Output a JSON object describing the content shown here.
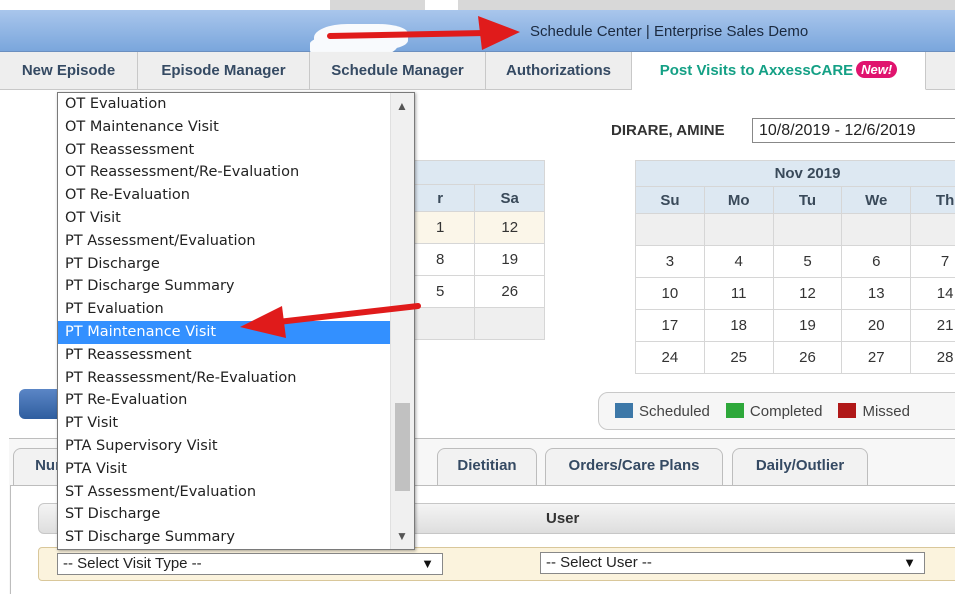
{
  "window": {
    "title": "Schedule Center | Enterprise Sales Demo"
  },
  "nav": {
    "items": [
      "New Episode",
      "Episode Manager",
      "Schedule Manager",
      "Authorizations",
      "Post Visits to AxxessCARE"
    ],
    "badge": "New!"
  },
  "patient": {
    "name": "DIRARE, AMINE",
    "date_range": "10/8/2019 - 12/6/2019"
  },
  "left_calendar": {
    "day_headers": [
      "r",
      "Sa"
    ],
    "rows": [
      [
        "1",
        "12"
      ],
      [
        "8",
        "19"
      ],
      [
        "5",
        "26"
      ],
      [
        "",
        ""
      ]
    ]
  },
  "right_calendar": {
    "month": "Nov 2019",
    "day_headers": [
      "Su",
      "Mo",
      "Tu",
      "We",
      "Th"
    ],
    "rows": [
      [
        "",
        "",
        "",
        "",
        ""
      ],
      [
        "3",
        "4",
        "5",
        "6",
        "7"
      ],
      [
        "10",
        "11",
        "12",
        "13",
        "14"
      ],
      [
        "17",
        "18",
        "19",
        "20",
        "21"
      ],
      [
        "24",
        "25",
        "26",
        "27",
        "28"
      ]
    ]
  },
  "legend": {
    "items": [
      {
        "label": "Scheduled",
        "color": "#3d78a8"
      },
      {
        "label": "Completed",
        "color": "#2ea83a"
      },
      {
        "label": "Missed",
        "color": "#b01818"
      }
    ]
  },
  "bottom_tabs": [
    "Nur",
    "Dietitian",
    "Orders/Care Plans",
    "Daily/Outlier"
  ],
  "grid": {
    "user_header": "User"
  },
  "filters": {
    "visit_type": "-- Select Visit Type --",
    "user": "-- Select User --"
  },
  "visit_type_options": [
    "OT Evaluation",
    "OT Maintenance Visit",
    "OT Reassessment",
    "OT Reassessment/Re-Evaluation",
    "OT Re-Evaluation",
    "OT Visit",
    "PT Assessment/Evaluation",
    "PT Discharge",
    "PT Discharge Summary",
    "PT Evaluation",
    "PT Maintenance Visit",
    "PT Reassessment",
    "PT Reassessment/Re-Evaluation",
    "PT Re-Evaluation",
    "PT Visit",
    "PTA Supervisory Visit",
    "PTA Visit",
    "ST Assessment/Evaluation",
    "ST Discharge",
    "ST Discharge Summary"
  ],
  "highlighted_option": "PT Maintenance Visit",
  "colors": {
    "accent": "#14a085",
    "highlight": "#3390ff",
    "arrow": "#e01b1b",
    "badge": "#e0146e"
  },
  "icons": {
    "scroll_up": "triangle-up-icon",
    "scroll_down": "triangle-down-icon",
    "dropdown": "triangle-down-icon"
  }
}
